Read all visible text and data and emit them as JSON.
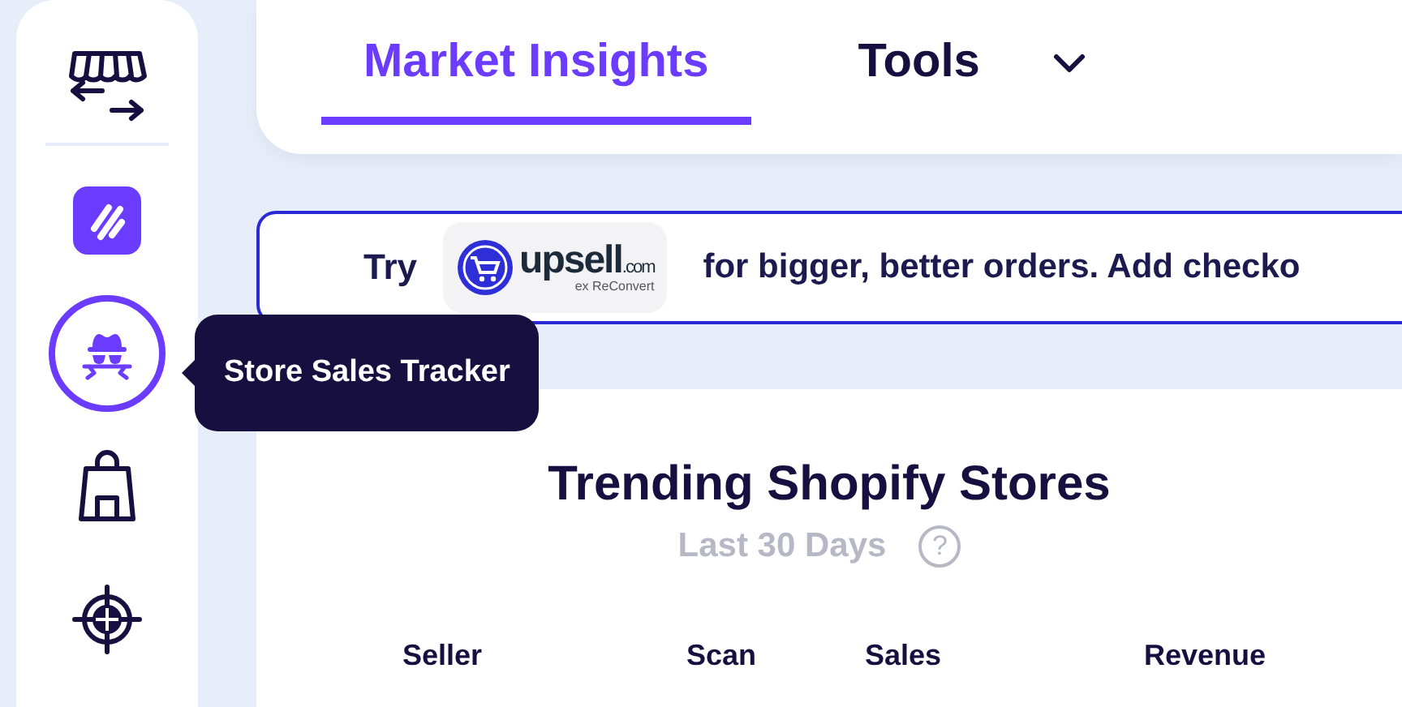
{
  "sidebar": {
    "items": [
      {
        "kind": "storefront",
        "selected": false
      },
      {
        "kind": "app",
        "selected": false
      },
      {
        "kind": "tracker",
        "selected": true
      },
      {
        "kind": "bag",
        "selected": false
      },
      {
        "kind": "target",
        "selected": false
      }
    ]
  },
  "tooltip": {
    "text": "Store Sales Tracker"
  },
  "nav": {
    "tabs": [
      {
        "label": "Market Insights",
        "selected": true,
        "dropdown": false
      },
      {
        "label": "Tools",
        "selected": false,
        "dropdown": true
      }
    ]
  },
  "banner": {
    "prefix": "Try",
    "logo": {
      "name": "upsell",
      "suffix": ".com",
      "tagline": "ex ReConvert"
    },
    "message": "for bigger, better orders. Add checko"
  },
  "card": {
    "title": "Trending Shopify Stores",
    "subtitle": "Last 30 Days",
    "help": "?",
    "columns": [
      "Seller",
      "Scan",
      "Sales",
      "Revenue"
    ]
  }
}
